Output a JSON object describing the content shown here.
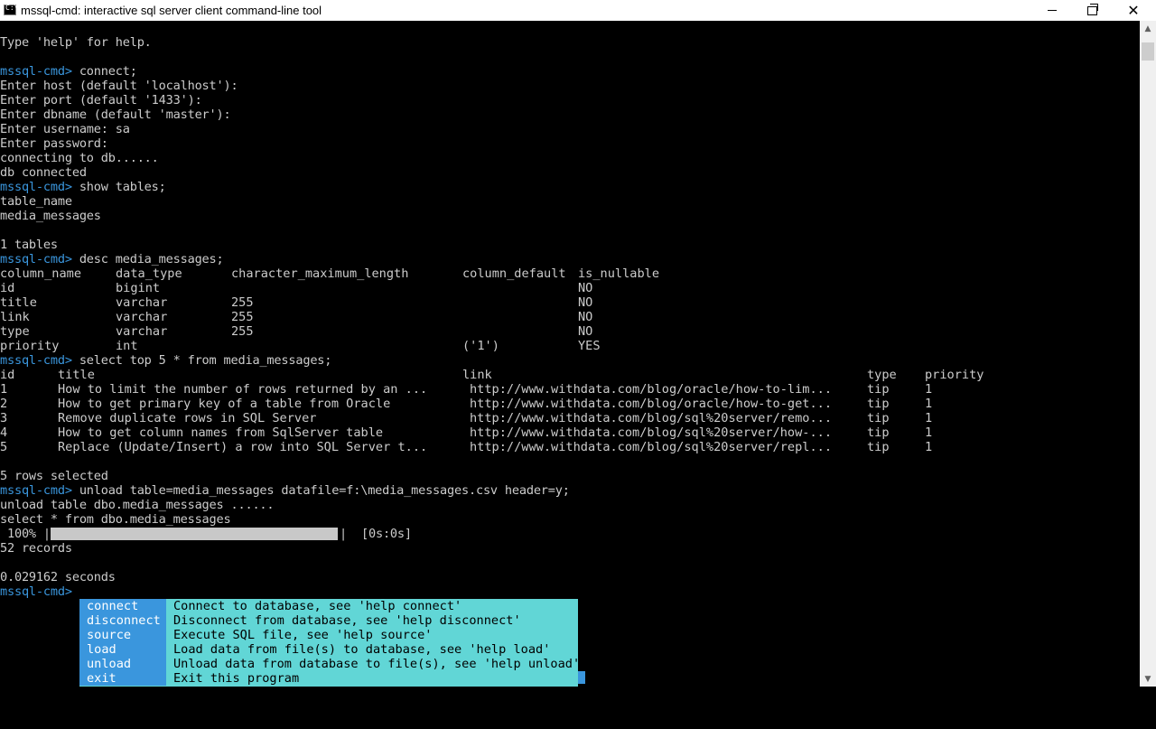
{
  "window": {
    "title": "mssql-cmd: interactive sql server client command-line tool",
    "icon_glyph": "C:\\",
    "icons": {
      "app": "console-icon",
      "minimize": "minimize-icon",
      "maximize": "maximize-icon",
      "close": "close-icon"
    }
  },
  "colors": {
    "background": "#000000",
    "text": "#cccccc",
    "prompt": "#3a96dd",
    "popup_bg": "#61d6d6",
    "popup_selected": "#3a96dd"
  },
  "prompt": "mssql-cmd>",
  "session": {
    "help_line": "Type 'help' for help.",
    "cmd_connect": " connect;",
    "host_prompt": "Enter host (default 'localhost'):",
    "port_prompt": "Enter port (default '1433'):",
    "dbname_prompt": "Enter dbname (default 'master'):",
    "username_prompt": "Enter username: sa",
    "password_prompt": "Enter password:",
    "connecting": "connecting to db......",
    "connected": "db connected",
    "cmd_show_tables": " show tables;",
    "show_tables_header": "table_name",
    "show_tables_row": "media_messages",
    "show_tables_count": "1 tables",
    "cmd_desc": " desc media_messages;",
    "cmd_select": " select top 5 * from media_messages;",
    "rows_selected": "5 rows selected",
    "cmd_unload": " unload table=media_messages datafile=f:\\media_messages.csv header=y;",
    "unload_status": "unload table dbo.media_messages ......",
    "unload_query": "select * from dbo.media_messages",
    "progress_percent": " 100% |",
    "progress_end": "|",
    "progress_time": "[0s:0s]",
    "progress_value": 1.0,
    "records": "52 records",
    "elapsed": "0.029162 seconds"
  },
  "desc_table": {
    "headers": [
      "column_name",
      "data_type",
      "character_maximum_length",
      "column_default",
      "is_nullable"
    ],
    "rows": [
      [
        "id",
        "bigint",
        "",
        "",
        "NO"
      ],
      [
        "title",
        "varchar",
        "255",
        "",
        "NO"
      ],
      [
        "link",
        "varchar",
        "255",
        "",
        "NO"
      ],
      [
        "type",
        "varchar",
        "255",
        "",
        "NO"
      ],
      [
        "priority",
        "int",
        "",
        "('1')",
        "YES"
      ]
    ]
  },
  "select_table": {
    "headers": [
      "id",
      "title",
      "link",
      "type",
      "priority"
    ],
    "rows": [
      [
        "1",
        "How to limit the number of rows returned by an ...",
        "http://www.withdata.com/blog/oracle/how-to-lim...",
        "tip",
        "1"
      ],
      [
        "2",
        "How to get primary key of a table from Oracle",
        "http://www.withdata.com/blog/oracle/how-to-get...",
        "tip",
        "1"
      ],
      [
        "3",
        "Remove duplicate rows in SQL Server",
        "http://www.withdata.com/blog/sql%20server/remo...",
        "tip",
        "1"
      ],
      [
        "4",
        "How to get column names from SqlServer table",
        "http://www.withdata.com/blog/sql%20server/how-...",
        "tip",
        "1"
      ],
      [
        "5",
        "Replace (Update/Insert) a row into SQL Server t...",
        "http://www.withdata.com/blog/sql%20server/repl...",
        "tip",
        "1"
      ]
    ]
  },
  "completion": [
    {
      "cmd": "connect",
      "desc": "Connect to database, see 'help connect'"
    },
    {
      "cmd": "disconnect",
      "desc": "Disconnect from database, see 'help disconnect'"
    },
    {
      "cmd": "source",
      "desc": "Execute SQL file, see 'help source'"
    },
    {
      "cmd": "load",
      "desc": "Load data from file(s) to database, see 'help load'"
    },
    {
      "cmd": "unload",
      "desc": "Unload data from database to file(s), see 'help unload'"
    },
    {
      "cmd": "exit",
      "desc": "Exit this program"
    }
  ],
  "scrollbar": {
    "up_glyph": "▲",
    "down_glyph": "▼"
  }
}
